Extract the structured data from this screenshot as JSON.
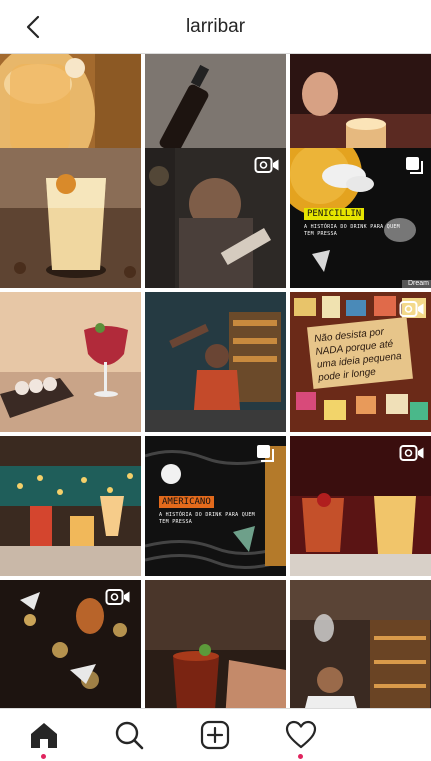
{
  "header": {
    "title": "larribar"
  },
  "grid": {
    "posts": [
      {
        "kind": "photo"
      },
      {
        "kind": "photo"
      },
      {
        "kind": "photo"
      },
      {
        "kind": "photo"
      },
      {
        "kind": "video",
        "icon": "video-camera-icon"
      },
      {
        "kind": "carousel",
        "icon": "carousel-icon",
        "poster_title": "PENICILLIN",
        "poster_subtitle": "A HISTÓRIA DO DRINK PARA QUEM TEM PRESSA",
        "brand": "Dream"
      },
      {
        "kind": "photo"
      },
      {
        "kind": "photo"
      },
      {
        "kind": "video",
        "icon": "video-camera-icon",
        "note": "Não desista por NADA porque até uma ideia pequena pode ir longe"
      },
      {
        "kind": "photo"
      },
      {
        "kind": "carousel",
        "icon": "carousel-icon",
        "poster_title": "AMERICANO",
        "poster_subtitle": "A HISTÓRIA DO DRINK PARA QUEM TEM PRESSA"
      },
      {
        "kind": "video",
        "icon": "video-camera-icon"
      },
      {
        "kind": "video",
        "icon": "video-camera-icon"
      },
      {
        "kind": "photo"
      },
      {
        "kind": "photo"
      }
    ]
  },
  "tabbar": {
    "items": [
      {
        "name": "home",
        "icon": "home-icon",
        "active": true
      },
      {
        "name": "search",
        "icon": "search-icon"
      },
      {
        "name": "new-post",
        "icon": "plus-square-icon"
      },
      {
        "name": "activity",
        "icon": "heart-icon",
        "notification": true
      }
    ]
  },
  "colors": {
    "notification_dot": "#e0245e",
    "icon": "#262626",
    "poster_yellow": "#e6e400",
    "poster_orange": "#e36a1c"
  }
}
